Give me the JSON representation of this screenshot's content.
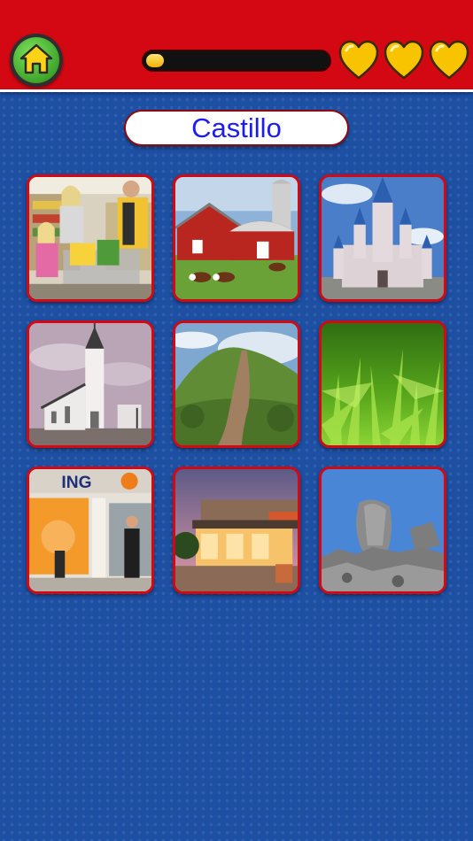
{
  "header": {
    "home_icon": "home-icon",
    "progress": 0.1,
    "lives": 3,
    "heart_icon": "heart-icon",
    "heart_color": "#f8c400",
    "accent_color": "#d40813"
  },
  "prompt": {
    "word": "Castillo"
  },
  "grid": {
    "tiles": [
      {
        "scene": "supermarket"
      },
      {
        "scene": "farm"
      },
      {
        "scene": "castle"
      },
      {
        "scene": "church"
      },
      {
        "scene": "hill-path"
      },
      {
        "scene": "grass"
      },
      {
        "scene": "bank",
        "sign": "ING"
      },
      {
        "scene": "restaurant"
      },
      {
        "scene": "rocks"
      }
    ]
  }
}
